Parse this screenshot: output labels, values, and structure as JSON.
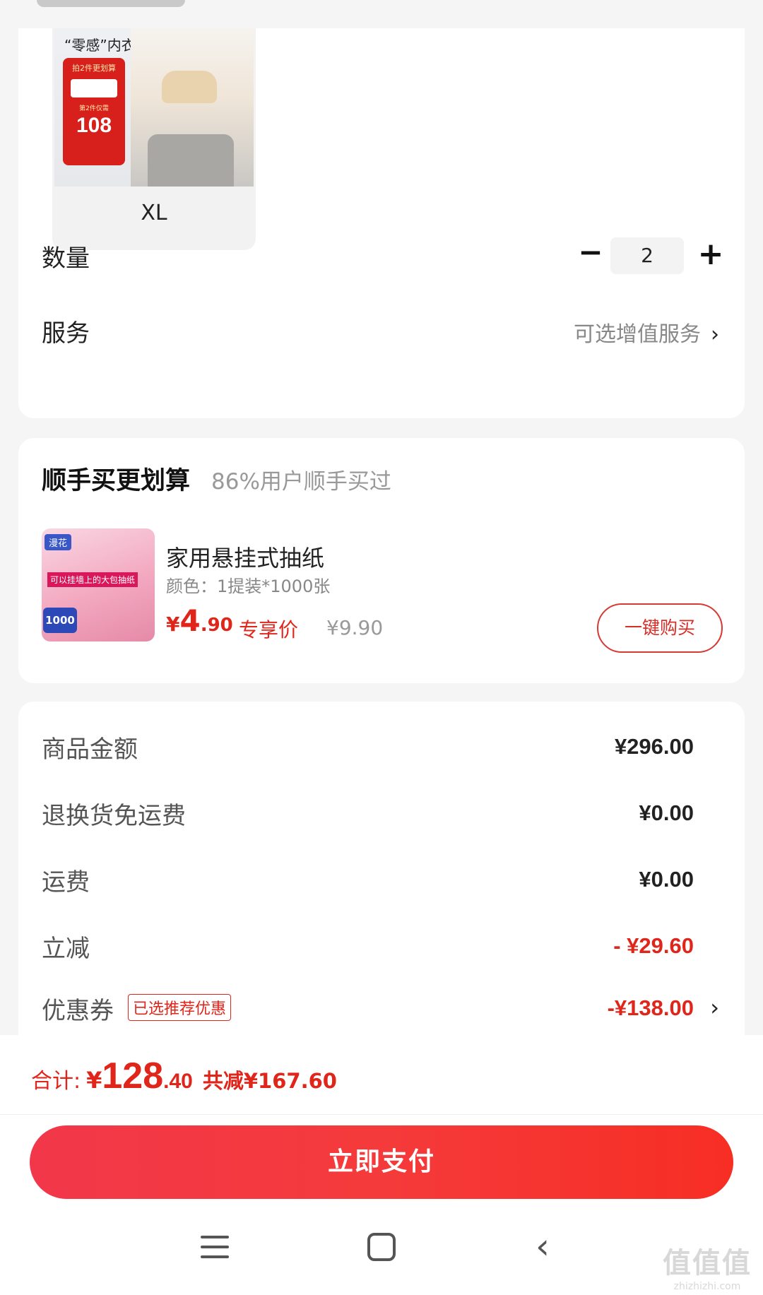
{
  "spec": {
    "sku": {
      "brand_text": "“零感”内衣",
      "promo_line1": "拍2件更划算",
      "promo_line2": "第2件仅需",
      "promo_price": "108",
      "size_label": "XL"
    },
    "quantity": {
      "label": "数量",
      "value": "2",
      "minus": "−",
      "plus": "+"
    },
    "service": {
      "label": "服务",
      "link": "可选增值服务",
      "chevron": "›"
    }
  },
  "addon": {
    "title": "顺手买更划算",
    "subtitle": "86%用户顺手买过",
    "product": {
      "thumb_tag": "漫花",
      "thumb_text": "可以挂墙上的大包抽纸",
      "thumb_badge": "1000",
      "name": "家用悬挂式抽纸",
      "spec": "颜色：1提装*1000张",
      "price_currency": "¥",
      "price_int": "4",
      "price_dec": ".90",
      "price_tag": "专享价",
      "original_price": "¥9.90",
      "buy_button": "一键购买"
    }
  },
  "summary": {
    "rows": [
      {
        "label": "商品金额",
        "value": "¥296.00"
      },
      {
        "label": "退换货免运费",
        "value": "¥0.00"
      },
      {
        "label": "运费",
        "value": "¥0.00"
      },
      {
        "label": "立减",
        "value": "- ¥29.60"
      },
      {
        "label": "优惠券",
        "tag": "已选推荐优惠",
        "value": "-¥138.00",
        "chevron": "›"
      }
    ]
  },
  "footer": {
    "total_label": "合计:",
    "total_currency": "¥",
    "total_int": "128",
    "total_dec": ".40",
    "saved_text": "共减¥167.60",
    "pay_button": "立即支付"
  },
  "watermark": {
    "big": "值值值",
    "small": "zhizhizhi.com"
  },
  "colors": {
    "accent_red": "#e0261b",
    "pay_gradient_start": "#f2374a",
    "pay_gradient_end": "#f72e24"
  }
}
